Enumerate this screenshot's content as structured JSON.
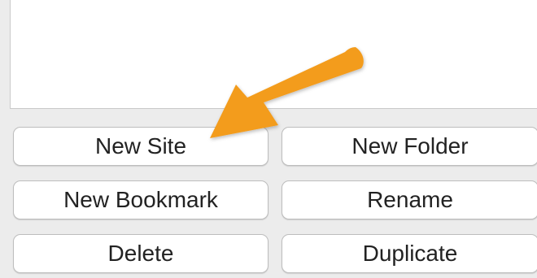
{
  "buttons": {
    "new_site": "New Site",
    "new_folder": "New Folder",
    "new_bookmark": "New Bookmark",
    "rename": "Rename",
    "delete": "Delete",
    "duplicate": "Duplicate"
  },
  "colors": {
    "arrow": "#f39c1f",
    "panel": "#ffffff",
    "window": "#ececec"
  },
  "icons": {
    "annotation": "arrow-icon"
  }
}
